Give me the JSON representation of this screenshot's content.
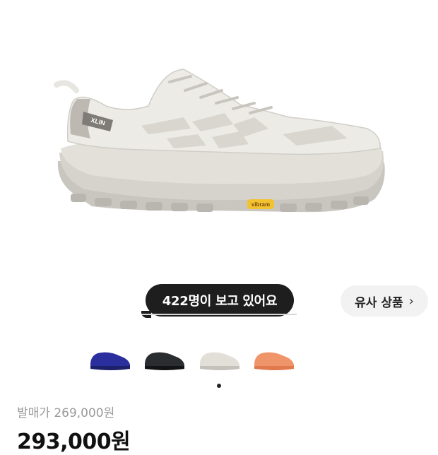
{
  "product": {
    "image_alt": "Hoka Mafate Speed 2 sneaker, white / grey",
    "sole_badge": "Vibram",
    "side_logo": "XLIN"
  },
  "viewers_badge": {
    "label": "422명이 보고 있어요"
  },
  "similar_button": {
    "label": "유사 상품",
    "chevron": "›"
  },
  "color_variants": [
    {
      "name": "blue",
      "color": "#2b2f9e"
    },
    {
      "name": "black",
      "color": "#2a2d2f"
    },
    {
      "name": "white",
      "color": "#dcd9d2"
    },
    {
      "name": "orange",
      "color": "#f0956a"
    }
  ],
  "pagination": {
    "current_page": 1,
    "total_pages": 1
  },
  "pricing": {
    "release_price_label": "발매가 269,000원",
    "current_price": "293,000원"
  },
  "colors": {
    "pill_bg": "#1e1e1e",
    "button_bg": "#f2f2f2"
  }
}
